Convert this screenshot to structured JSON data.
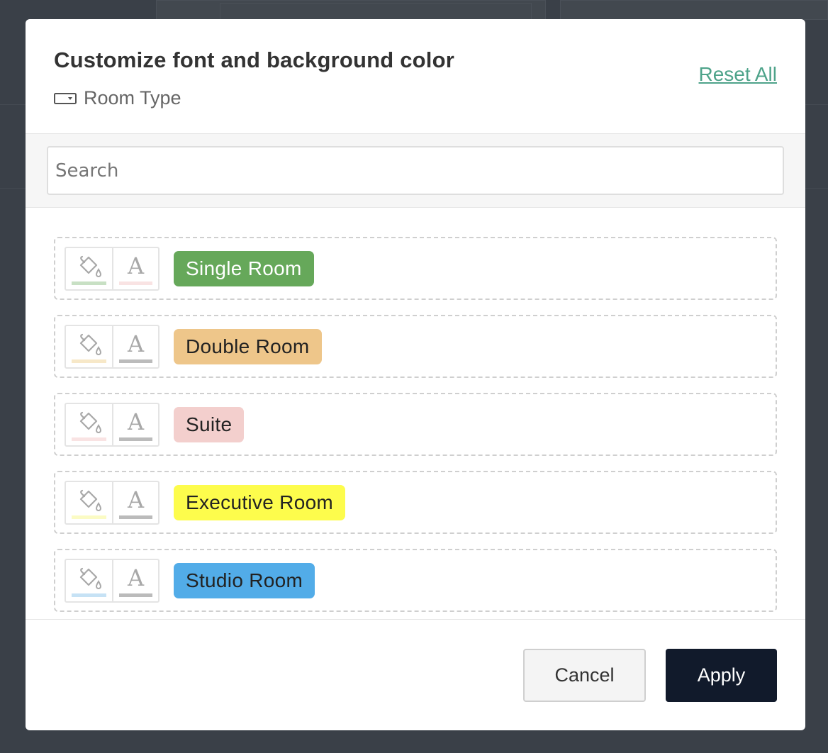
{
  "modal": {
    "title": "Customize font and background color",
    "subtitle": "Room Type",
    "reset_label": "Reset All"
  },
  "search": {
    "placeholder": "Search"
  },
  "items": [
    {
      "label": "Single Room",
      "bg": "#66a85a",
      "fg": "#ffffff",
      "bg_swatch": "#c8e0c4",
      "fg_swatch": "#f9e3e3"
    },
    {
      "label": "Double Room",
      "bg": "#eec68a",
      "fg": "#222222",
      "bg_swatch": "#f7e8c8",
      "fg_swatch": "#bbbbbb"
    },
    {
      "label": "Suite",
      "bg": "#f3cfcd",
      "fg": "#222222",
      "bg_swatch": "#f9e3e3",
      "fg_swatch": "#bbbbbb"
    },
    {
      "label": "Executive Room",
      "bg": "#fdfc4c",
      "fg": "#222222",
      "bg_swatch": "#fbfbc4",
      "fg_swatch": "#bbbbbb"
    },
    {
      "label": "Studio Room",
      "bg": "#52ace8",
      "fg": "#222222",
      "bg_swatch": "#c6e2f5",
      "fg_swatch": "#bbbbbb"
    }
  ],
  "footer": {
    "cancel_label": "Cancel",
    "apply_label": "Apply"
  },
  "colors": {
    "accent": "#4ea38a",
    "primary_button": "#111a2b",
    "backdrop": "#3a4048"
  }
}
